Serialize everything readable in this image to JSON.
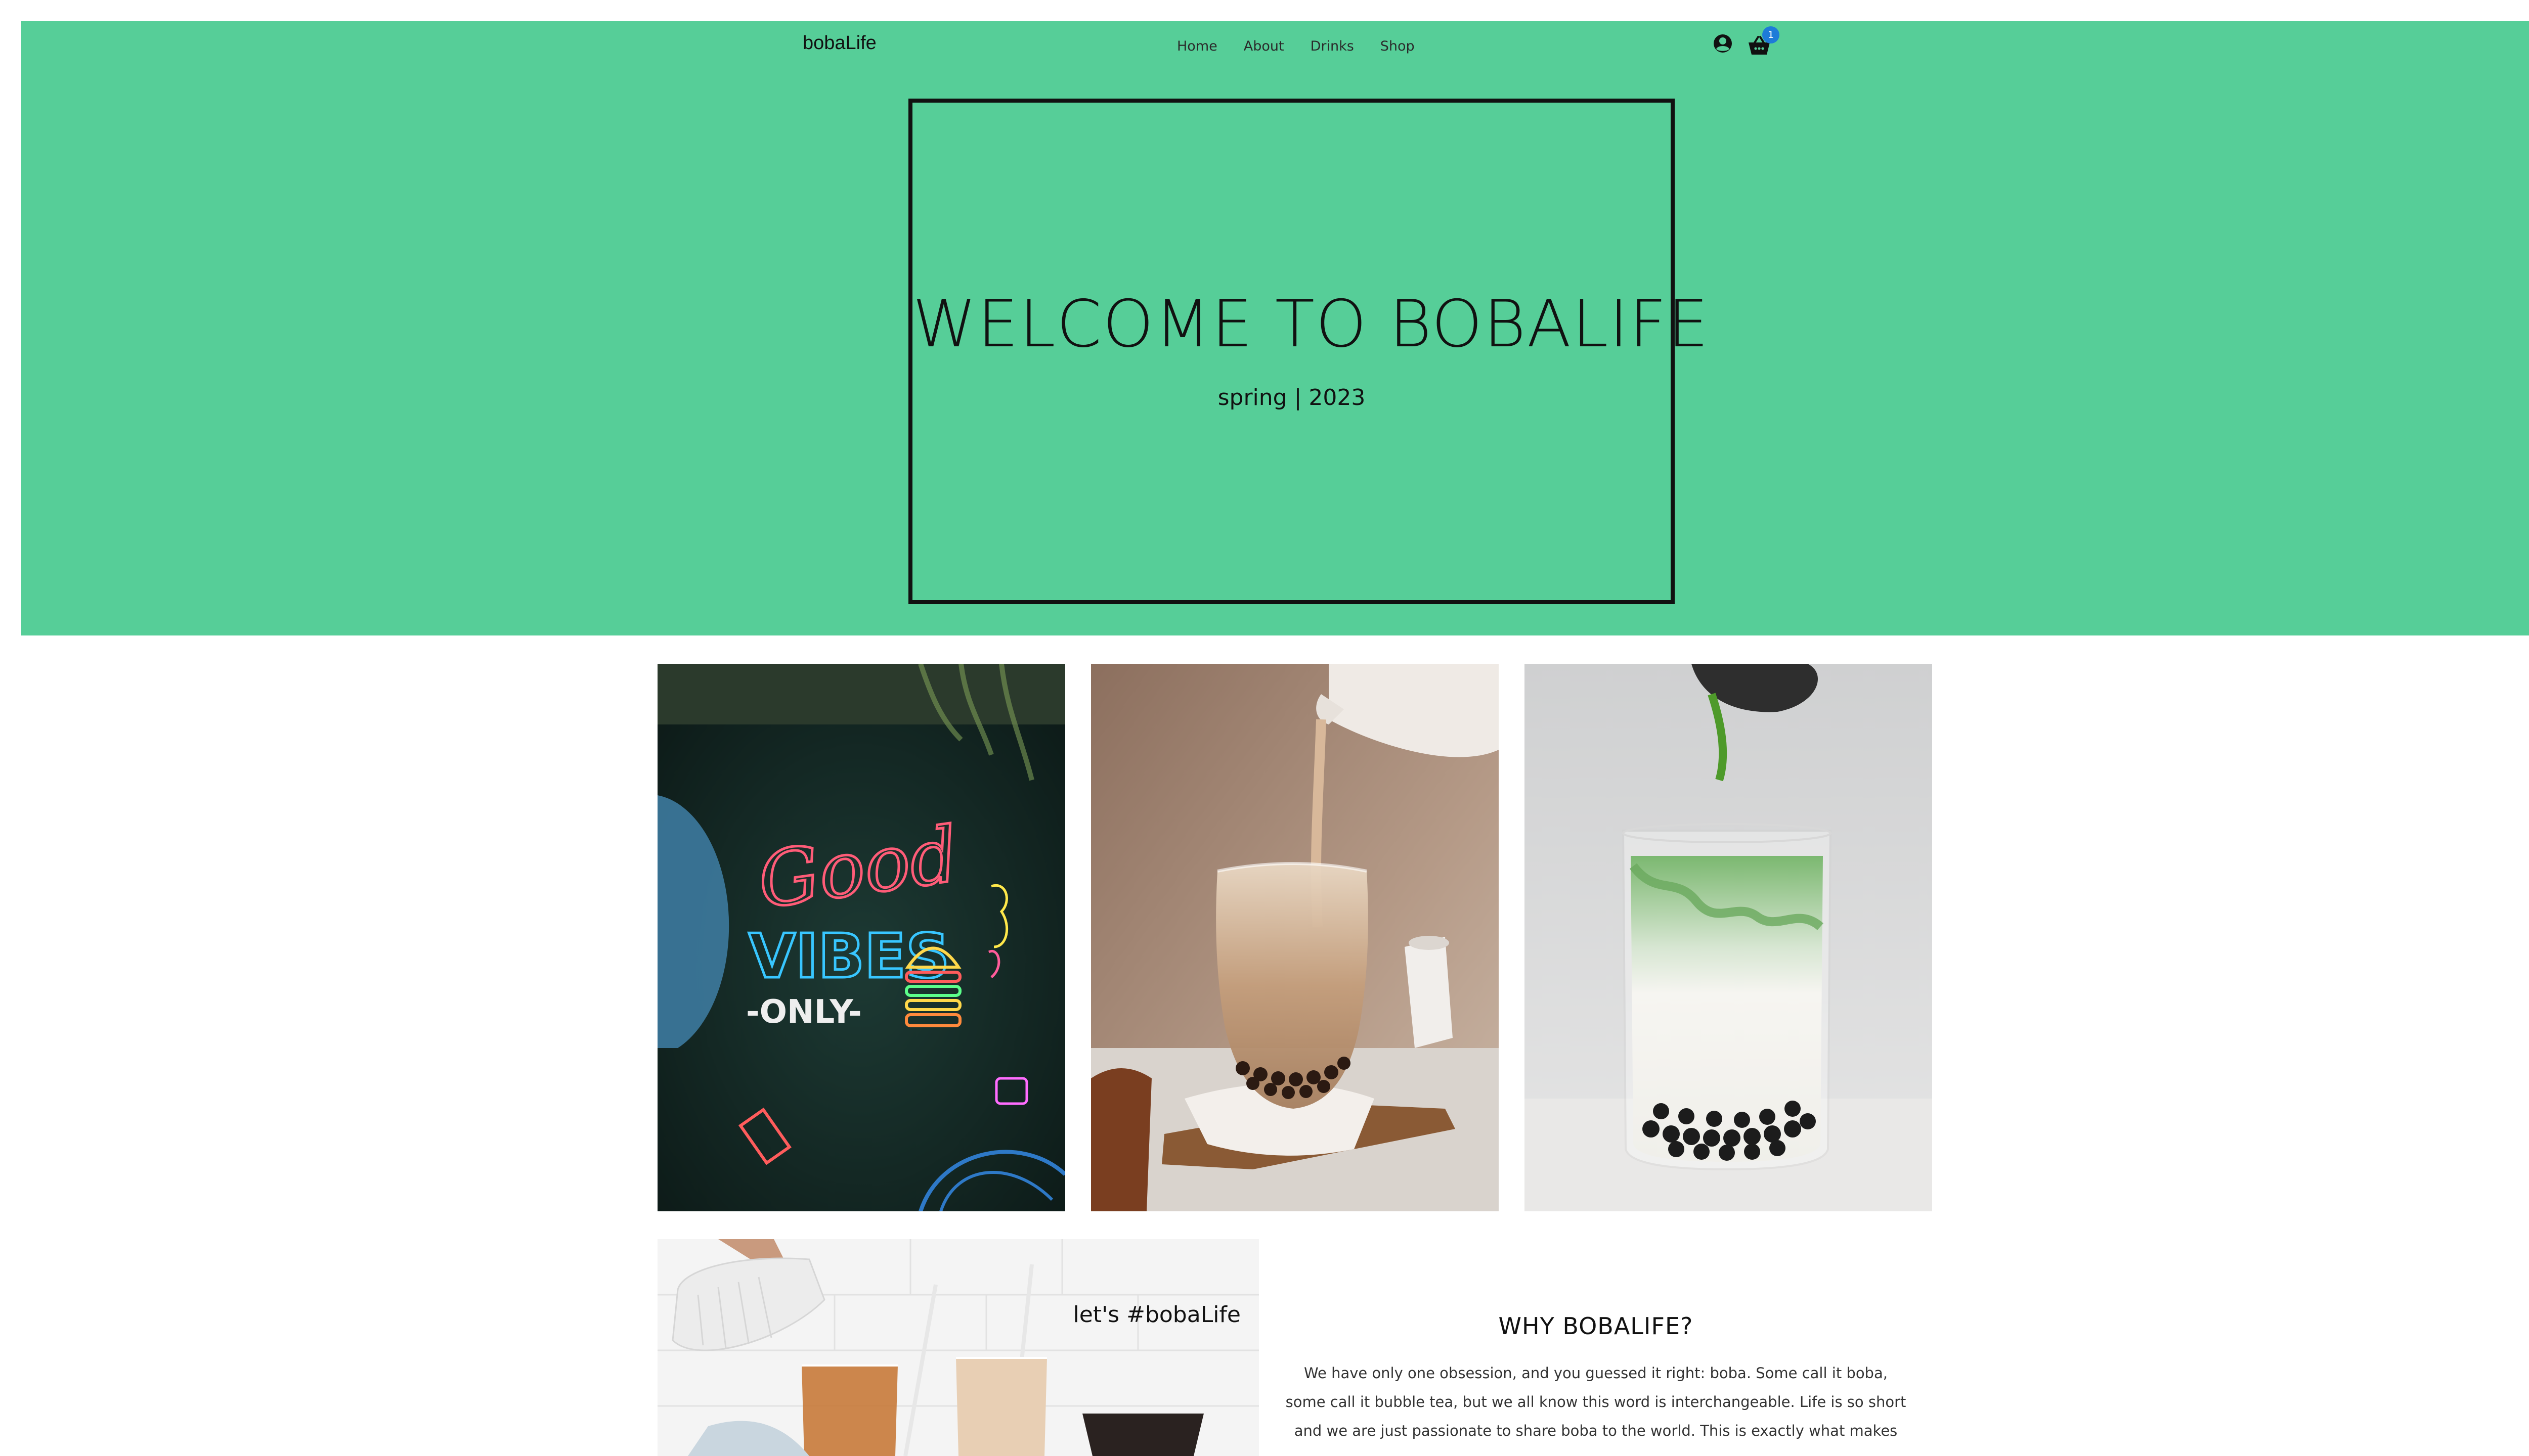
{
  "header": {
    "brand": "bobaLife",
    "nav": [
      {
        "label": "Home"
      },
      {
        "label": "About"
      },
      {
        "label": "Drinks"
      },
      {
        "label": "Shop"
      }
    ],
    "account_icon": "user-circle-icon",
    "cart_icon": "basket-icon",
    "cart_count": "1"
  },
  "hero": {
    "title": "WELCOME TO BOBALIFE",
    "subtitle": "spring | 2023"
  },
  "gallery": [
    {
      "name": "neon-good-vibes-photo",
      "neon": [
        "Good",
        "VIBES",
        "-ONLY-"
      ]
    },
    {
      "name": "milk-tea-pour-photo"
    },
    {
      "name": "matcha-latte-pour-photo"
    }
  ],
  "promo": {
    "caption": "let's #bobaLife"
  },
  "why": {
    "title": "WHY BOBALIFE?",
    "lines": [
      "We have only one obsession, and you guessed it right: boba. Some call it boba,",
      "some call it bubble tea, but we all know this word is interchangeable. Life is so short",
      "and we are just passionate to share boba to the world. This is exactly what makes"
    ]
  },
  "colors": {
    "hero_bg": "#56CE98",
    "frame": "#111111",
    "badge": "#1E7BD8"
  }
}
